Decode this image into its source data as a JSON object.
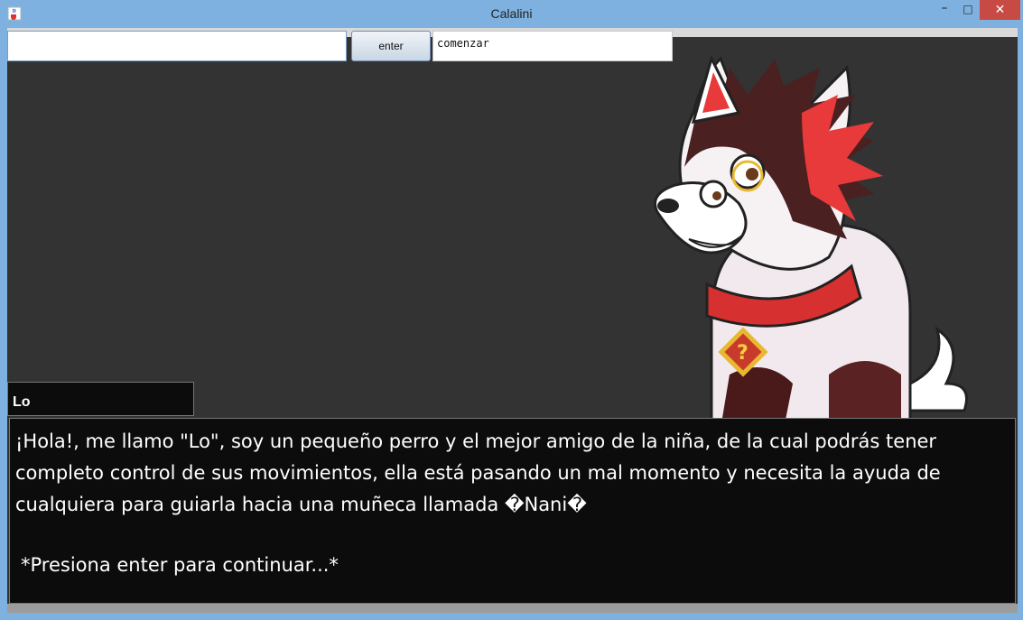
{
  "window": {
    "title": "Calalini",
    "minimize_glyph": "–",
    "maximize_glyph": "□",
    "close_glyph": "✕"
  },
  "toolbar": {
    "main_input_value": "",
    "enter_label": "enter",
    "command_value": "comenzar"
  },
  "scene": {
    "character_image": "white-dog-with-red-collar",
    "icon": "java-cup-icon"
  },
  "dialog": {
    "speaker": "Lo",
    "lines": [
      "¡Hola!, me llamo \"Lo\", soy un pequeño perro y el mejor amigo de la niña, de la cual podrás tener",
      "completo control de sus movimientos, ella está pasando un mal momento y necesita la ayuda de",
      "cualquiera para guiarla hacia una muñeca llamada �Nani�"
    ],
    "hint": "*Presiona enter para continuar...*"
  },
  "colors": {
    "background": "#333333",
    "dialog_bg": "#0c0c0c",
    "titlebar": "#7fb1e0",
    "close_button": "#c74a45"
  }
}
